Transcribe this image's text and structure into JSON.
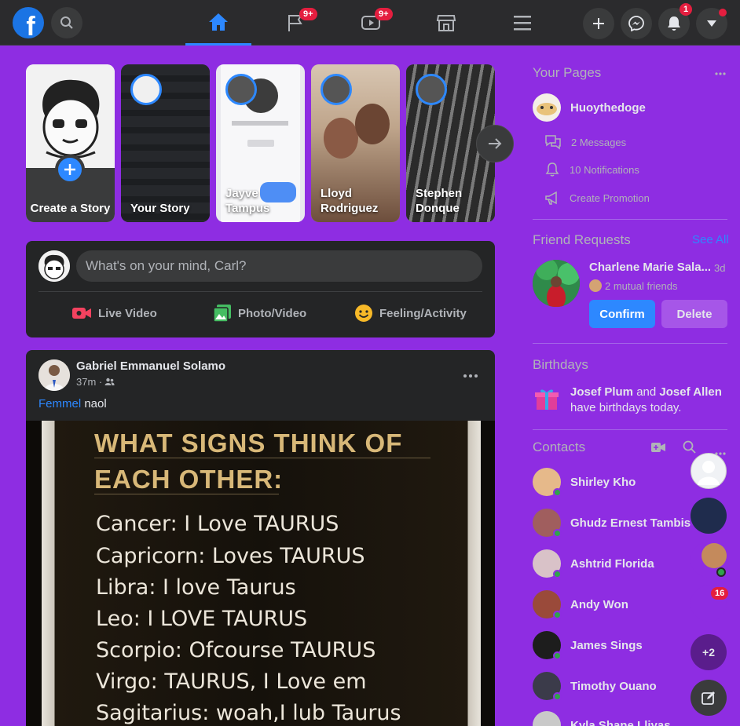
{
  "nav": {
    "messages_badge": "9+",
    "watch_badge": "9+",
    "notifications_badge": "1"
  },
  "stories": [
    {
      "label": "Create a Story"
    },
    {
      "label": "Your Story"
    },
    {
      "label": "Jayve Tampus"
    },
    {
      "label": "Lloyd Rodriguez"
    },
    {
      "label": "Stephen Donque"
    }
  ],
  "composer": {
    "placeholder": "What's on your mind, Carl?",
    "live_video": "Live Video",
    "photo_video": "Photo/Video",
    "feeling": "Feeling/Activity"
  },
  "post": {
    "author": "Gabriel Emmanuel Solamo",
    "time": "37m ·",
    "tag": "Femmel",
    "text": "naol",
    "image_title_1": "WHAT SIGNS THINK OF",
    "image_title_2": "EACH OTHER:",
    "image_lines": [
      "Cancer: I Love TAURUS",
      "Capricorn: Loves TAURUS",
      "Libra: I love Taurus",
      "Leo: I LOVE TAURUS",
      "Scorpio: Ofcourse TAURUS",
      "Virgo: TAURUS, I Love em",
      "Sagitarius: woah,I lub Taurus"
    ]
  },
  "right": {
    "pages_title": "Your Pages",
    "page_name": "Huoythedoge",
    "messages": "2 Messages",
    "notifications": "10 Notifications",
    "promotion": "Create Promotion",
    "requests_title": "Friend Requests",
    "see_all": "See All",
    "request_name": "Charlene Marie Sala...",
    "request_time": "3d",
    "mutual": "2 mutual friends",
    "confirm": "Confirm",
    "delete": "Delete",
    "birthdays_title": "Birthdays",
    "birthday_name_1": "Josef Plum",
    "birthday_and": " and ",
    "birthday_name_2": "Josef Allen",
    "birthday_rest": "have birthdays today.",
    "contacts_title": "Contacts",
    "contacts": [
      "Shirley Kho",
      "Ghudz Ernest Tambis",
      "Ashtrid Florida",
      "Andy Won",
      "James Sings",
      "Timothy Ouano",
      "Kyla Shane Lliyas"
    ]
  },
  "chat_heads": {
    "badge": "16",
    "more": "+2"
  },
  "colors": {
    "background": "#8e2de2",
    "accent": "#2d88ff",
    "card": "#242526",
    "topbar": "#2b2b2d"
  }
}
